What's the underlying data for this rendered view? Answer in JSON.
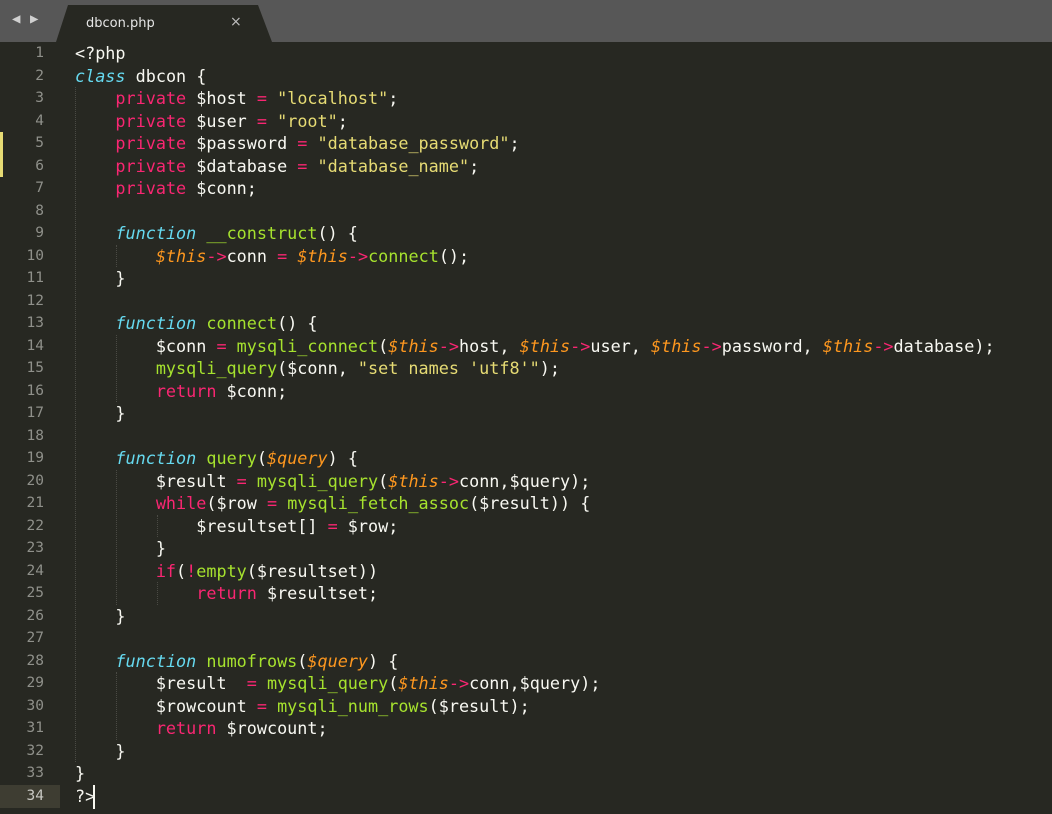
{
  "tab": {
    "title": "dbcon.php",
    "close_glyph": "×",
    "nav_prev": "◀",
    "nav_next": "▶"
  },
  "editor": {
    "current_line": 34,
    "modified_lines": [
      5,
      6
    ],
    "theme_colors": {
      "background": "#272822",
      "foreground": "#f8f8f2",
      "keyword": "#f92672",
      "string": "#e6db74",
      "function_name": "#a6e22e",
      "storage": "#66d9ef",
      "variable": "#fd971f",
      "line_number": "#8f908a"
    },
    "lines": [
      [
        [
          "t",
          "<?php"
        ]
      ],
      [
        [
          "st",
          "class"
        ],
        [
          "t",
          " dbcon {"
        ]
      ],
      [
        [
          "t",
          "    "
        ],
        [
          "k",
          "private"
        ],
        [
          "t",
          " $host "
        ],
        [
          "k",
          "="
        ],
        [
          "t",
          " "
        ],
        [
          "s",
          "\"localhost\""
        ],
        [
          "t",
          ";"
        ]
      ],
      [
        [
          "t",
          "    "
        ],
        [
          "k",
          "private"
        ],
        [
          "t",
          " $user "
        ],
        [
          "k",
          "="
        ],
        [
          "t",
          " "
        ],
        [
          "s",
          "\"root\""
        ],
        [
          "t",
          ";"
        ]
      ],
      [
        [
          "t",
          "    "
        ],
        [
          "k",
          "private"
        ],
        [
          "t",
          " $password "
        ],
        [
          "k",
          "="
        ],
        [
          "t",
          " "
        ],
        [
          "s",
          "\"database_password\""
        ],
        [
          "t",
          ";"
        ]
      ],
      [
        [
          "t",
          "    "
        ],
        [
          "k",
          "private"
        ],
        [
          "t",
          " $database "
        ],
        [
          "k",
          "="
        ],
        [
          "t",
          " "
        ],
        [
          "s",
          "\"database_name\""
        ],
        [
          "t",
          ";"
        ]
      ],
      [
        [
          "t",
          "    "
        ],
        [
          "k",
          "private"
        ],
        [
          "t",
          " $conn;"
        ]
      ],
      [],
      [
        [
          "t",
          "    "
        ],
        [
          "st",
          "function"
        ],
        [
          "t",
          " "
        ],
        [
          "f",
          "__construct"
        ],
        [
          "t",
          "() {"
        ]
      ],
      [
        [
          "t",
          "        "
        ],
        [
          "v",
          "$this"
        ],
        [
          "k",
          "->"
        ],
        [
          "t",
          "conn "
        ],
        [
          "k",
          "="
        ],
        [
          "t",
          " "
        ],
        [
          "v",
          "$this"
        ],
        [
          "k",
          "->"
        ],
        [
          "f",
          "connect"
        ],
        [
          "t",
          "();"
        ]
      ],
      [
        [
          "t",
          "    }"
        ]
      ],
      [],
      [
        [
          "t",
          "    "
        ],
        [
          "st",
          "function"
        ],
        [
          "t",
          " "
        ],
        [
          "f",
          "connect"
        ],
        [
          "t",
          "() {"
        ]
      ],
      [
        [
          "t",
          "        $conn "
        ],
        [
          "k",
          "="
        ],
        [
          "t",
          " "
        ],
        [
          "f",
          "mysqli_connect"
        ],
        [
          "t",
          "("
        ],
        [
          "v",
          "$this"
        ],
        [
          "k",
          "->"
        ],
        [
          "t",
          "host, "
        ],
        [
          "v",
          "$this"
        ],
        [
          "k",
          "->"
        ],
        [
          "t",
          "user, "
        ],
        [
          "v",
          "$this"
        ],
        [
          "k",
          "->"
        ],
        [
          "t",
          "password, "
        ],
        [
          "v",
          "$this"
        ],
        [
          "k",
          "->"
        ],
        [
          "t",
          "database);"
        ]
      ],
      [
        [
          "t",
          "        "
        ],
        [
          "f",
          "mysqli_query"
        ],
        [
          "t",
          "($conn, "
        ],
        [
          "s",
          "\"set names 'utf8'\""
        ],
        [
          "t",
          ");"
        ]
      ],
      [
        [
          "t",
          "        "
        ],
        [
          "k",
          "return"
        ],
        [
          "t",
          " $conn;"
        ]
      ],
      [
        [
          "t",
          "    }"
        ]
      ],
      [],
      [
        [
          "t",
          "    "
        ],
        [
          "st",
          "function"
        ],
        [
          "t",
          " "
        ],
        [
          "f",
          "query"
        ],
        [
          "t",
          "("
        ],
        [
          "v",
          "$query"
        ],
        [
          "t",
          ") {"
        ]
      ],
      [
        [
          "t",
          "        $result "
        ],
        [
          "k",
          "="
        ],
        [
          "t",
          " "
        ],
        [
          "f",
          "mysqli_query"
        ],
        [
          "t",
          "("
        ],
        [
          "v",
          "$this"
        ],
        [
          "k",
          "->"
        ],
        [
          "t",
          "conn,$query);"
        ]
      ],
      [
        [
          "t",
          "        "
        ],
        [
          "k",
          "while"
        ],
        [
          "t",
          "($row "
        ],
        [
          "k",
          "="
        ],
        [
          "t",
          " "
        ],
        [
          "f",
          "mysqli_fetch_assoc"
        ],
        [
          "t",
          "($result)) {"
        ]
      ],
      [
        [
          "t",
          "            $resultset[] "
        ],
        [
          "k",
          "="
        ],
        [
          "t",
          " $row;"
        ]
      ],
      [
        [
          "t",
          "        }"
        ]
      ],
      [
        [
          "t",
          "        "
        ],
        [
          "k",
          "if"
        ],
        [
          "t",
          "("
        ],
        [
          "k",
          "!"
        ],
        [
          "f",
          "empty"
        ],
        [
          "t",
          "($resultset))"
        ]
      ],
      [
        [
          "t",
          "            "
        ],
        [
          "k",
          "return"
        ],
        [
          "t",
          " $resultset;"
        ]
      ],
      [
        [
          "t",
          "    }"
        ]
      ],
      [],
      [
        [
          "t",
          "    "
        ],
        [
          "st",
          "function"
        ],
        [
          "t",
          " "
        ],
        [
          "f",
          "numofrows"
        ],
        [
          "t",
          "("
        ],
        [
          "v",
          "$query"
        ],
        [
          "t",
          ") {"
        ]
      ],
      [
        [
          "t",
          "        $result  "
        ],
        [
          "k",
          "="
        ],
        [
          "t",
          " "
        ],
        [
          "f",
          "mysqli_query"
        ],
        [
          "t",
          "("
        ],
        [
          "v",
          "$this"
        ],
        [
          "k",
          "->"
        ],
        [
          "t",
          "conn,$query);"
        ]
      ],
      [
        [
          "t",
          "        $rowcount "
        ],
        [
          "k",
          "="
        ],
        [
          "t",
          " "
        ],
        [
          "f",
          "mysqli_num_rows"
        ],
        [
          "t",
          "($result);"
        ]
      ],
      [
        [
          "t",
          "        "
        ],
        [
          "k",
          "return"
        ],
        [
          "t",
          " $rowcount;"
        ]
      ],
      [
        [
          "t",
          "    }"
        ]
      ],
      [
        [
          "t",
          "}"
        ]
      ],
      [
        [
          "t",
          "?>"
        ]
      ]
    ]
  }
}
